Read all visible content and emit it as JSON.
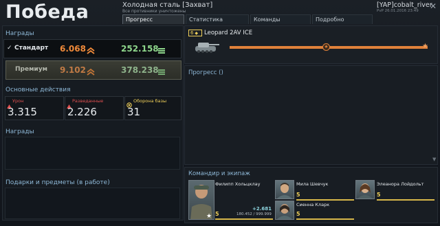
{
  "header": {
    "result_title": "Победа",
    "battle_name": "Холодная сталь [Захват]",
    "battle_sub": "Все противники уничтожены",
    "player_name": "[YAP]cobalt_river",
    "player_date": "PvP 26.01.2016 23:49",
    "close_icon": "✕"
  },
  "tabs": [
    {
      "label": "Прогресс",
      "active": true
    },
    {
      "label": "Статистика"
    },
    {
      "label": "Команды"
    },
    {
      "label": "Подробно"
    }
  ],
  "rewards": {
    "title": "Награды",
    "standard": {
      "check": "✓",
      "label": "Стандарт",
      "xp": "6.068",
      "credits": "252.158"
    },
    "premium": {
      "label": "Премиум",
      "xp": "9.102",
      "credits": "378.238"
    }
  },
  "actions": {
    "title": "Основные действия",
    "items": [
      {
        "label": "Урон",
        "value": "3.315",
        "color": "#e05050"
      },
      {
        "label": "Разведанные",
        "value": "2.226",
        "color": "#e05050"
      },
      {
        "label": "Оборона базы",
        "value": "31",
        "color": "#f0d05a"
      }
    ]
  },
  "awards": {
    "title": "Награды"
  },
  "gifts": {
    "title": "Подарки и предметы (в работе)"
  },
  "vehicle": {
    "tier": "6",
    "name": "Leopard 2AV ICE",
    "progress": 1.0
  },
  "progress": {
    "title": "Прогресс ()"
  },
  "crew": {
    "title": "Командир и экипаж",
    "commander": {
      "name": "Филипп Хольцклау",
      "level": "5",
      "xp_gain": "+2.681",
      "xp_total": "180.452 / 999.999"
    },
    "members": [
      {
        "name": "Мила Шевчук",
        "level": "5"
      },
      {
        "name": "Элеанора Лойдольт",
        "level": "5"
      },
      {
        "name": "Сиенна Кларк",
        "level": "5"
      }
    ]
  },
  "colors": {
    "accent": "#f08a3a",
    "green": "#8ed68b",
    "blue": "#8fb9d8",
    "gold": "#f0d05a"
  }
}
